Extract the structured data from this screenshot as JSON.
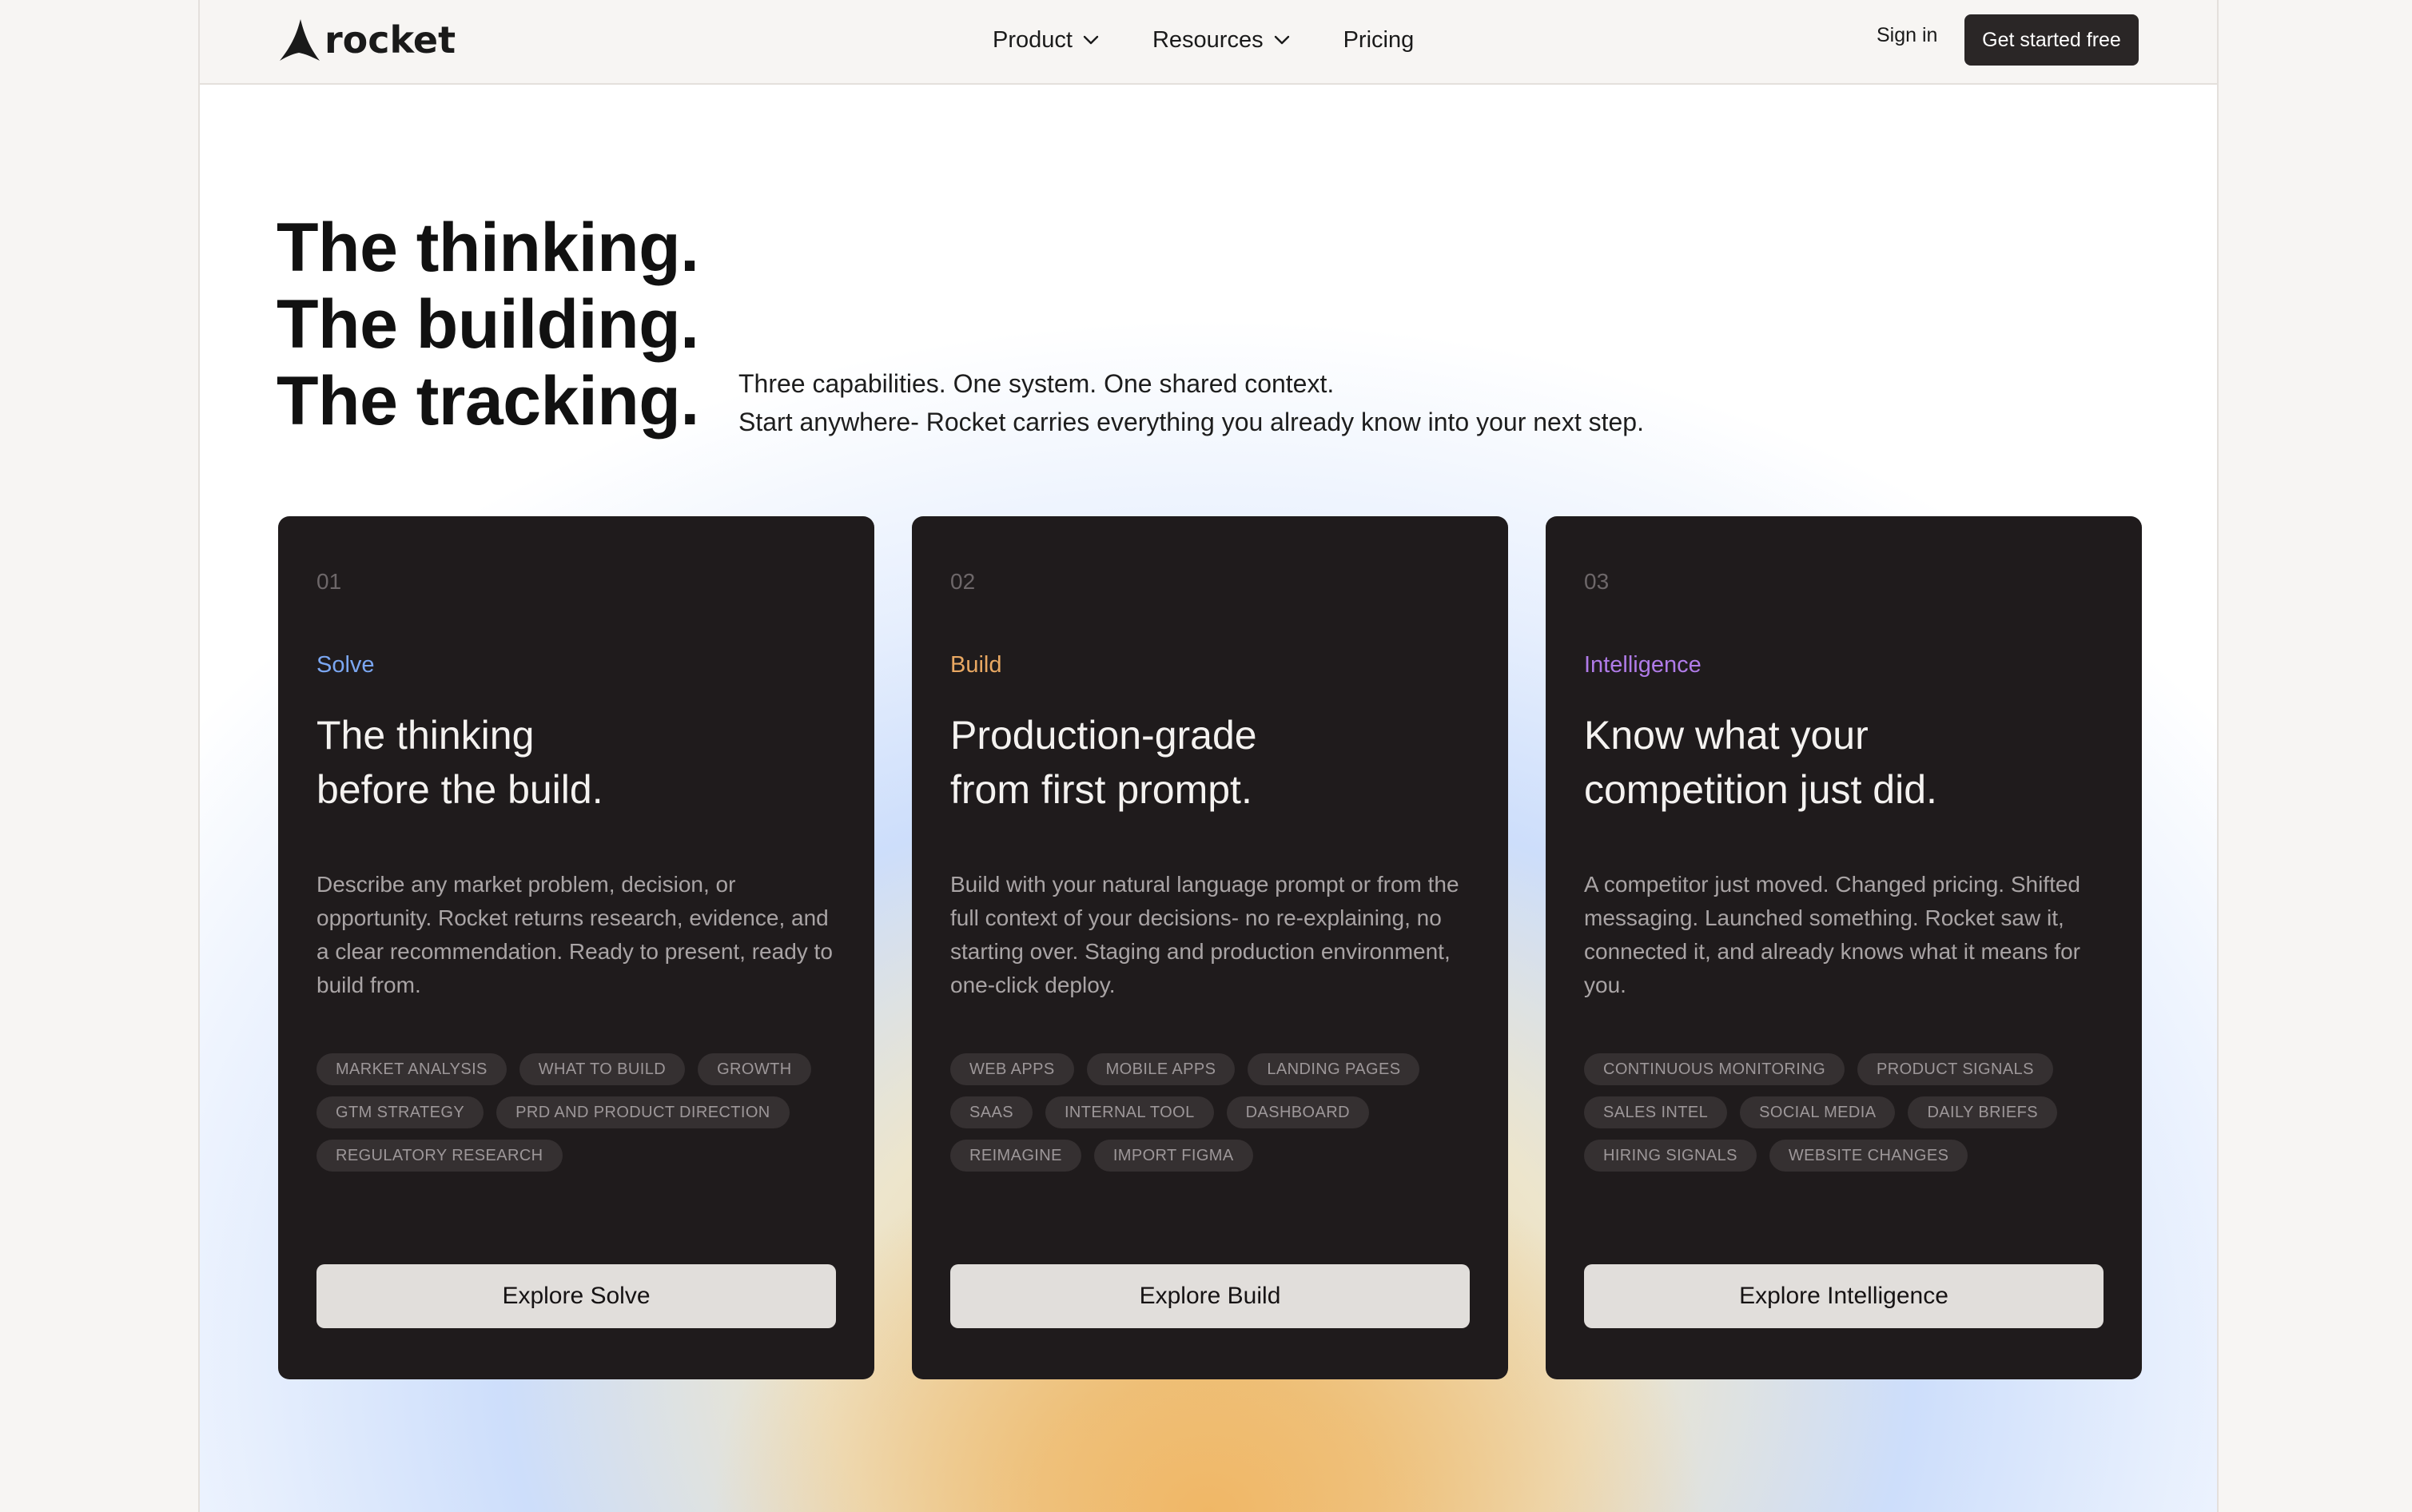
{
  "brand": {
    "name": "rocket"
  },
  "nav": {
    "items": [
      {
        "label": "Product",
        "has_dropdown": true
      },
      {
        "label": "Resources",
        "has_dropdown": true
      },
      {
        "label": "Pricing",
        "has_dropdown": false
      }
    ],
    "sign_in": "Sign in",
    "cta": "Get started free"
  },
  "hero": {
    "headline": [
      "The thinking.",
      "The building.",
      "The tracking."
    ],
    "subtext": [
      "Three capabilities. One system. One shared context.",
      "Start anywhere- Rocket carries everything you already know into your next step."
    ]
  },
  "cards": [
    {
      "number": "01",
      "tag": "Solve",
      "tag_color": "#7ba7f2",
      "title": [
        "The thinking",
        "before the build."
      ],
      "description": "Describe any market problem, decision, or opportunity. Rocket returns research, evidence, and a clear recommendation. Ready to present, ready to build from.",
      "chips": [
        "MARKET ANALYSIS",
        "WHAT TO BUILD",
        "GROWTH",
        "GTM STRATEGY",
        "PRD AND PRODUCT DIRECTION",
        "REGULATORY RESEARCH"
      ],
      "button": "Explore Solve"
    },
    {
      "number": "02",
      "tag": "Build",
      "tag_color": "#e9a862",
      "title": [
        "Production-grade",
        "from first prompt."
      ],
      "description": "Build with your natural language prompt or from the full context of your decisions- no re-explaining, no starting over. Staging and production environment, one-click deploy.",
      "chips": [
        "WEB APPS",
        "MOBILE APPS",
        "LANDING PAGES",
        "SAAS",
        "INTERNAL TOOL",
        "DASHBOARD",
        "REIMAGINE",
        "IMPORT FIGMA"
      ],
      "button": "Explore Build"
    },
    {
      "number": "03",
      "tag": "Intelligence",
      "tag_color": "#b07be8",
      "title": [
        "Know what your",
        "competition just did."
      ],
      "description": "A competitor just moved. Changed pricing. Shifted messaging. Launched something. Rocket saw it, connected it, and already knows what it means for you.",
      "chips": [
        "CONTINUOUS MONITORING",
        "PRODUCT SIGNALS",
        "SALES INTEL",
        "SOCIAL MEDIA",
        "DAILY BRIEFS",
        "HIRING SIGNALS",
        "WEBSITE CHANGES"
      ],
      "button": "Explore Intelligence"
    }
  ]
}
